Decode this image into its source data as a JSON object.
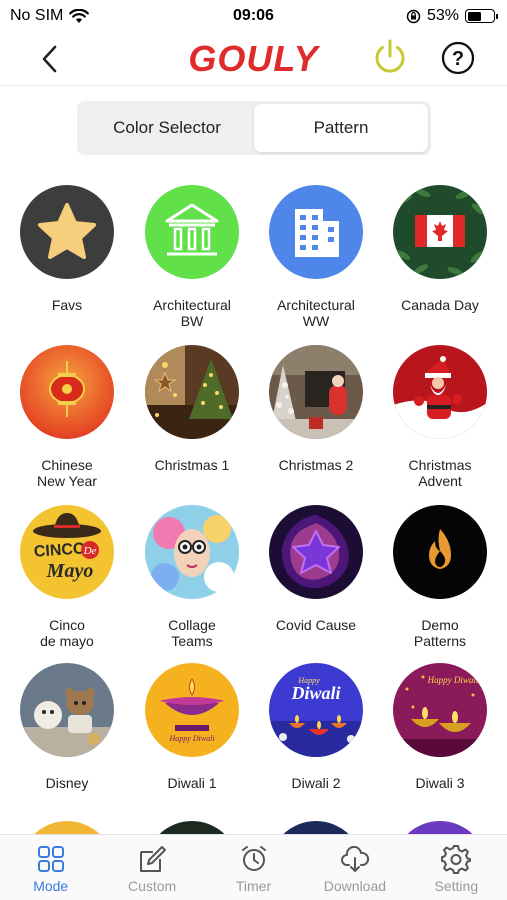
{
  "status_bar": {
    "carrier": "No SIM",
    "time": "09:06",
    "battery_percent": "53%",
    "battery_level": 0.53,
    "icons": [
      "wifi-icon",
      "orientation-lock-icon",
      "battery-icon"
    ]
  },
  "header": {
    "brand": "GOULY",
    "brand_color": "#e02b2b",
    "power_color": "#c8c832",
    "icons": [
      "chevron-left-icon",
      "power-icon",
      "help-icon"
    ]
  },
  "segmented": {
    "tabs": [
      {
        "label": "Color Selector",
        "active": false
      },
      {
        "label": "Pattern",
        "active": true
      }
    ]
  },
  "patterns": [
    {
      "label": "Favs"
    },
    {
      "label": "Architectural\nBW"
    },
    {
      "label": "Architectural\nWW"
    },
    {
      "label": "Canada Day"
    },
    {
      "label": "Chinese\nNew Year"
    },
    {
      "label": "Christmas 1"
    },
    {
      "label": "Christmas 2"
    },
    {
      "label": "Christmas\nAdvent"
    },
    {
      "label": "Cinco\nde mayo"
    },
    {
      "label": "Collage\nTeams"
    },
    {
      "label": "Covid Cause"
    },
    {
      "label": "Demo\nPatterns"
    },
    {
      "label": "Disney"
    },
    {
      "label": "Diwali 1"
    },
    {
      "label": "Diwali 2"
    },
    {
      "label": "Diwali 3"
    }
  ],
  "thumb_texts": {
    "cinco": "CINCO",
    "de": "De",
    "mayo": "Mayo",
    "diwali1": "Happy Diwali",
    "diwali2_happy": "Happy",
    "diwali2": "Diwali",
    "diwali3": "Happy Diwali"
  },
  "tabbar": {
    "active_color": "#3a7be0",
    "inactive_color": "#9a9a9a",
    "tabs": [
      {
        "label": "Mode",
        "icon": "grid-icon",
        "active": true
      },
      {
        "label": "Custom",
        "icon": "edit-icon",
        "active": false
      },
      {
        "label": "Timer",
        "icon": "alarm-clock-icon",
        "active": false
      },
      {
        "label": "Download",
        "icon": "cloud-download-icon",
        "active": false
      },
      {
        "label": "Setting",
        "icon": "gear-icon",
        "active": false
      }
    ]
  }
}
